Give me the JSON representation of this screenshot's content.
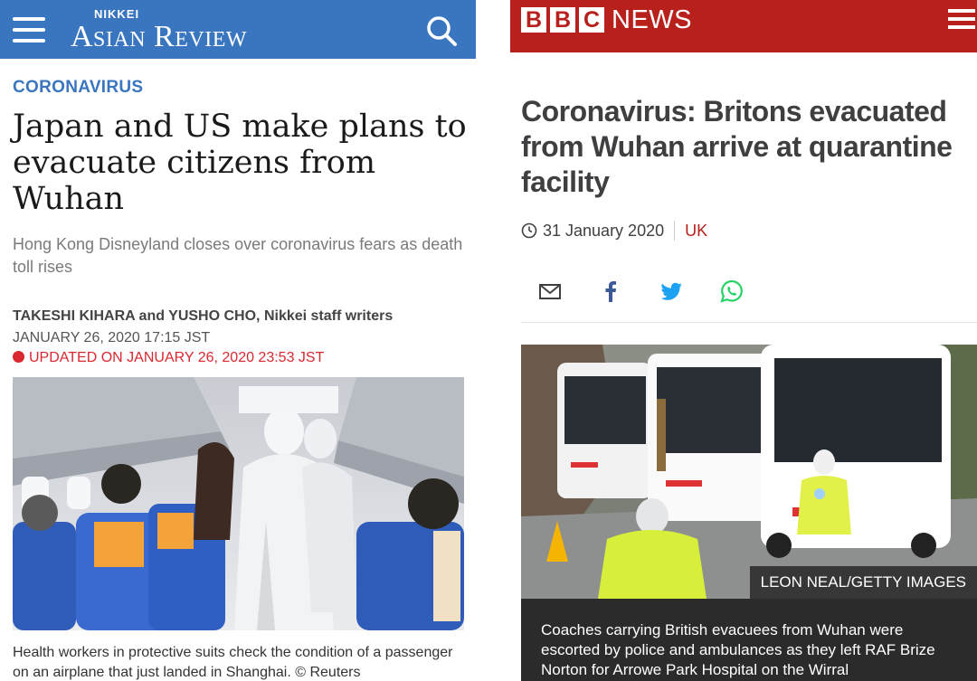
{
  "nikkei": {
    "logo_top": "NIKKEI",
    "logo_main": "Asian Review",
    "section": "CORONAVIRUS",
    "headline": "Japan and US make plans to evacuate citizens from Wuhan",
    "subhead": "Hong Kong Disneyland closes over coronavirus fears as death toll rises",
    "byline": "TAKESHI KIHARA and YUSHO CHO, Nikkei staff writers",
    "date": "JANUARY 26, 2020 17:15 JST",
    "updated": "UPDATED ON JANUARY 26, 2020 23:53 JST",
    "caption": "Health workers in protective suits check the condition of a passenger on an airplane that just landed in Shanghai.   © Reuters",
    "colors": {
      "brand": "#3a76c0",
      "alert": "#d9282f"
    }
  },
  "bbc": {
    "logo_letters": [
      "B",
      "B",
      "C"
    ],
    "logo_news": "NEWS",
    "headline": "Coronavirus: Britons evacuated from Wuhan arrive at quarantine facility",
    "date": "31 January 2020",
    "tag": "UK",
    "share_icons": [
      "email-icon",
      "facebook-icon",
      "twitter-icon",
      "whatsapp-icon"
    ],
    "photo_credit": "LEON NEAL/GETTY IMAGES",
    "caption": "Coaches carrying British evacuees from Wuhan were escorted by police and ambulances as they left RAF Brize Norton for Arrowe Park Hospital on the Wirral",
    "colors": {
      "brand": "#b8201c"
    }
  }
}
